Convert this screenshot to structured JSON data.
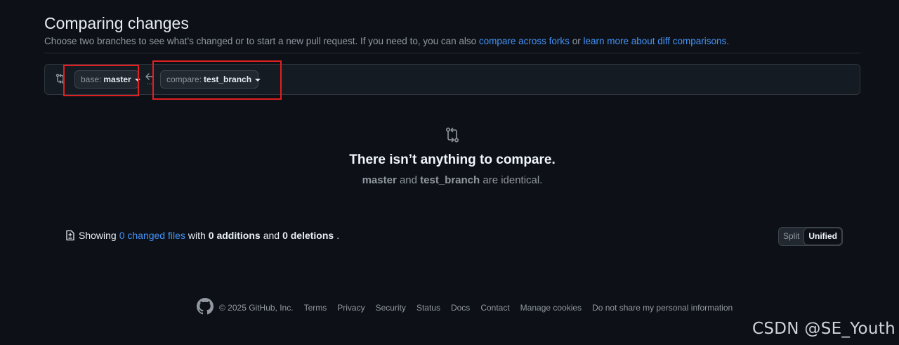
{
  "header": {
    "title": "Comparing changes",
    "subtitle_text": "Choose two branches to see what’s changed or to start a new pull request. If you need to, you can also ",
    "link_forks": "compare across forks",
    "or": " or ",
    "link_learn": "learn more about diff comparisons",
    "period": "."
  },
  "range": {
    "base_prefix": "base:",
    "base_branch": "master",
    "compare_prefix": "compare:",
    "compare_branch": "test_branch",
    "dots": "..."
  },
  "blank": {
    "title": "There isn’t anything to compare.",
    "base": "master",
    "and": " and ",
    "compare": "test_branch",
    "suffix": " are identical."
  },
  "toc": {
    "showing": "Showing",
    "changed_files": "0 changed files",
    "with": "with",
    "additions": "0 additions",
    "and": "and",
    "deletions": "0 deletions",
    "period": "."
  },
  "view": {
    "split": "Split",
    "unified": "Unified"
  },
  "footer": {
    "copyright": "© 2025 GitHub, Inc.",
    "links": [
      "Terms",
      "Privacy",
      "Security",
      "Status",
      "Docs",
      "Contact",
      "Manage cookies",
      "Do not share my personal information"
    ]
  },
  "watermark": "CSDN @SE_Youth",
  "colors": {
    "background": "#0d1117",
    "link": "#4493f8",
    "highlight": "#e02020"
  }
}
